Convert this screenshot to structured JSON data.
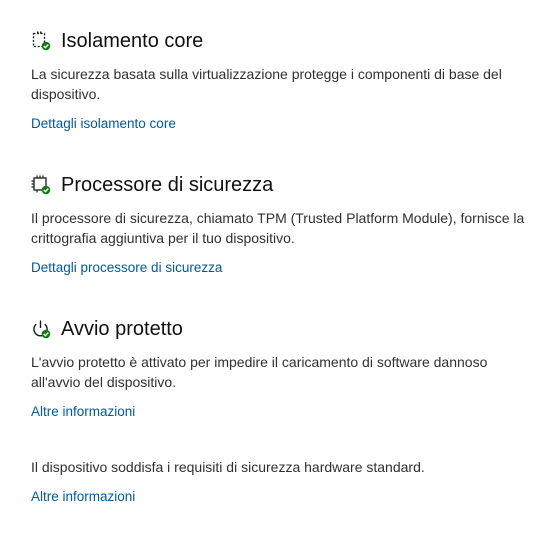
{
  "sections": [
    {
      "icon": "core-isolation-icon",
      "title": "Isolamento core",
      "description": "La sicurezza basata sulla virtualizzazione protegge i componenti di base del dispositivo.",
      "link": "Dettagli isolamento core"
    },
    {
      "icon": "security-processor-icon",
      "title": "Processore di sicurezza",
      "description": "Il processore di sicurezza, chiamato TPM (Trusted Platform Module), fornisce la crittografia aggiuntiva per il tuo dispositivo.",
      "link": "Dettagli processore di sicurezza"
    },
    {
      "icon": "secure-boot-icon",
      "title": "Avvio protetto",
      "description": "L'avvio protetto è attivato per impedire il caricamento di software dannoso all'avvio del dispositivo.",
      "link": "Altre informazioni"
    }
  ],
  "footer": {
    "description": "Il dispositivo soddisfa i requisiti di sicurezza hardware standard.",
    "link": "Altre informazioni"
  },
  "colors": {
    "link": "#005a9e",
    "check": "#107c10",
    "text": "#303030"
  }
}
